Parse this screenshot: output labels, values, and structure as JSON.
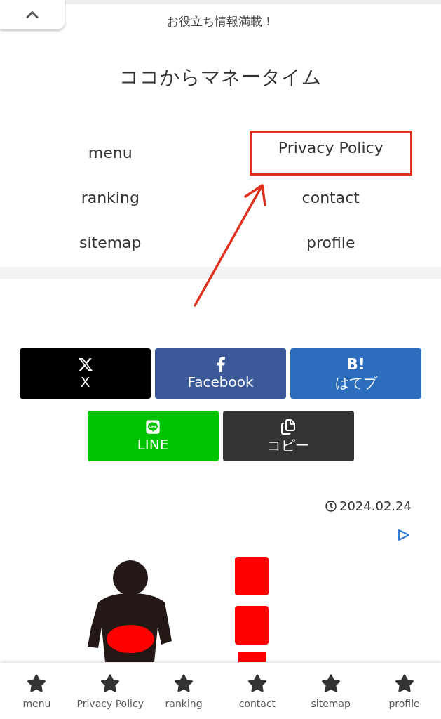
{
  "header": {
    "tagline": "お役立ち情報満載！",
    "site_title": "ココからマネータイム"
  },
  "nav": [
    {
      "label": "menu",
      "highlighted": false
    },
    {
      "label": "Privacy Policy",
      "highlighted": true
    },
    {
      "label": "ranking",
      "highlighted": false
    },
    {
      "label": "contact",
      "highlighted": false
    },
    {
      "label": "sitemap",
      "highlighted": false
    },
    {
      "label": "profile",
      "highlighted": false
    }
  ],
  "share_buttons": [
    {
      "kind": "x",
      "label": "X"
    },
    {
      "kind": "facebook",
      "label": "Facebook"
    },
    {
      "kind": "hatena",
      "label": "はてブ",
      "icon_text": "B!"
    },
    {
      "kind": "line",
      "label": "LINE"
    },
    {
      "kind": "copy",
      "label": "コピー"
    }
  ],
  "post": {
    "date": "2024.02.24"
  },
  "bottom_nav": [
    {
      "label": "menu"
    },
    {
      "label": "Privacy Policy"
    },
    {
      "label": "ranking"
    },
    {
      "label": "contact"
    },
    {
      "label": "sitemap"
    },
    {
      "label": "profile"
    }
  ]
}
